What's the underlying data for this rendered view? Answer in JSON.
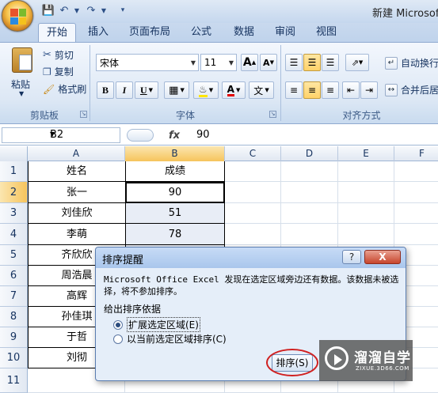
{
  "title_bar": {
    "title": "新建 Microsoft"
  },
  "tabs": [
    "开始",
    "插入",
    "页面布局",
    "公式",
    "数据",
    "审阅",
    "视图"
  ],
  "ribbon": {
    "clipboard": {
      "paste": "粘贴",
      "cut": "剪切",
      "copy": "复制",
      "format_painter": "格式刷",
      "group_label": "剪贴板"
    },
    "font": {
      "font_name": "宋体",
      "font_size": "11",
      "group_label": "字体",
      "bold": "B",
      "italic": "I",
      "underline": "U",
      "grow": "A",
      "shrink": "A",
      "font_color": "A",
      "phonetic": "文"
    },
    "alignment": {
      "wrap_text": "自动换行",
      "merge_center": "合并后居",
      "group_label": "对齐方式"
    }
  },
  "formula_bar": {
    "name_box": "B2",
    "fx": "fx",
    "value": "90"
  },
  "sheet": {
    "columns": [
      "A",
      "B",
      "C",
      "D",
      "E",
      "F"
    ],
    "rows": [
      "1",
      "2",
      "3",
      "4",
      "5",
      "6",
      "7",
      "8",
      "9",
      "10",
      "11"
    ],
    "header": {
      "a": "姓名",
      "b": "成绩"
    },
    "data": [
      {
        "name": "张一",
        "score": "90"
      },
      {
        "name": "刘佳欣",
        "score": "51"
      },
      {
        "name": "李萌",
        "score": "78"
      },
      {
        "name": "齐欣欣",
        "score": ""
      },
      {
        "name": "周浩晨",
        "score": ""
      },
      {
        "name": "高辉",
        "score": ""
      },
      {
        "name": "孙佳琪",
        "score": ""
      },
      {
        "name": "于哲",
        "score": ""
      },
      {
        "name": "刘彻",
        "score": ""
      }
    ]
  },
  "dialog": {
    "title": "排序提醒",
    "help": "?",
    "close": "X",
    "message": "Microsoft Office Excel 发现在选定区域旁边还有数据。该数据未被选择，将不参加排序。",
    "group_label": "给出排序依据",
    "option_expand": "扩展选定区域(E)",
    "option_current": "以当前选定区域排序(C)",
    "sort_button": "排序(S)"
  },
  "watermark": {
    "name": "溜溜自学",
    "url": "ZIXUE.3D66.COM"
  }
}
